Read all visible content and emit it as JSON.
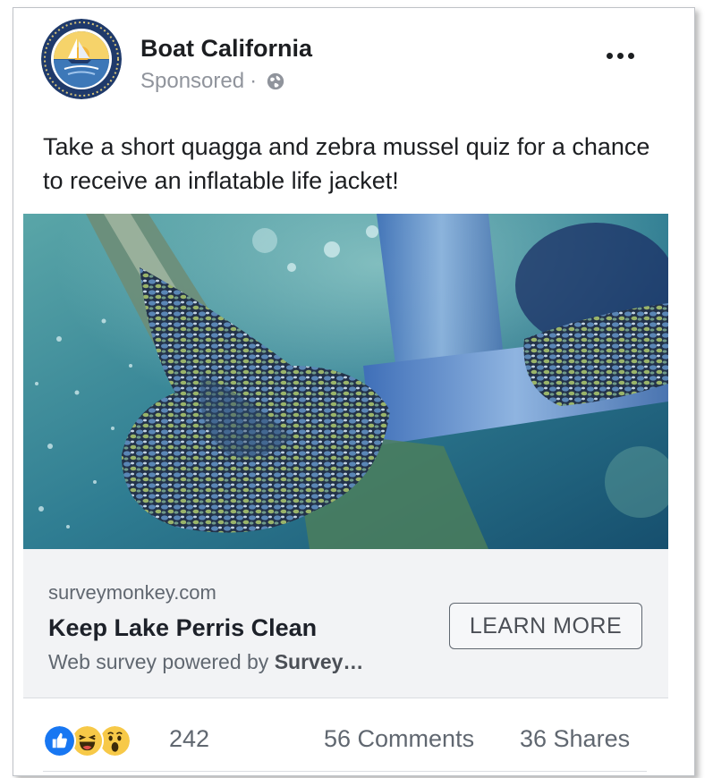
{
  "post": {
    "page_name": "Boat California",
    "sponsored_label": "Sponsored",
    "separator": "·",
    "audience_icon": "globe-icon",
    "avatar_icon": "boat-california-logo",
    "more_icon": "more-options-icon",
    "text": "Take a short quagga and zebra mussel quiz for a chance to receive an inflatable life jacket!"
  },
  "link_preview": {
    "domain": "surveymonkey.com",
    "title": "Keep Lake Perris Clean",
    "description_prefix": "Web survey powered by",
    "description_bold": "Survey…",
    "cta_label": "LEARN MORE"
  },
  "image": {
    "subject": "underwater-propeller-mussels-image"
  },
  "engagement": {
    "reactions": [
      "like-icon",
      "haha-icon",
      "wow-icon"
    ],
    "reaction_count": "242",
    "comments": "56 Comments",
    "shares": "36 Shares"
  },
  "colors": {
    "like_blue": "#1877f2",
    "emoji_yellow": "#f7c948",
    "text_primary": "#1c1e21",
    "text_secondary": "#606770",
    "link_box_bg": "#f2f3f5"
  }
}
